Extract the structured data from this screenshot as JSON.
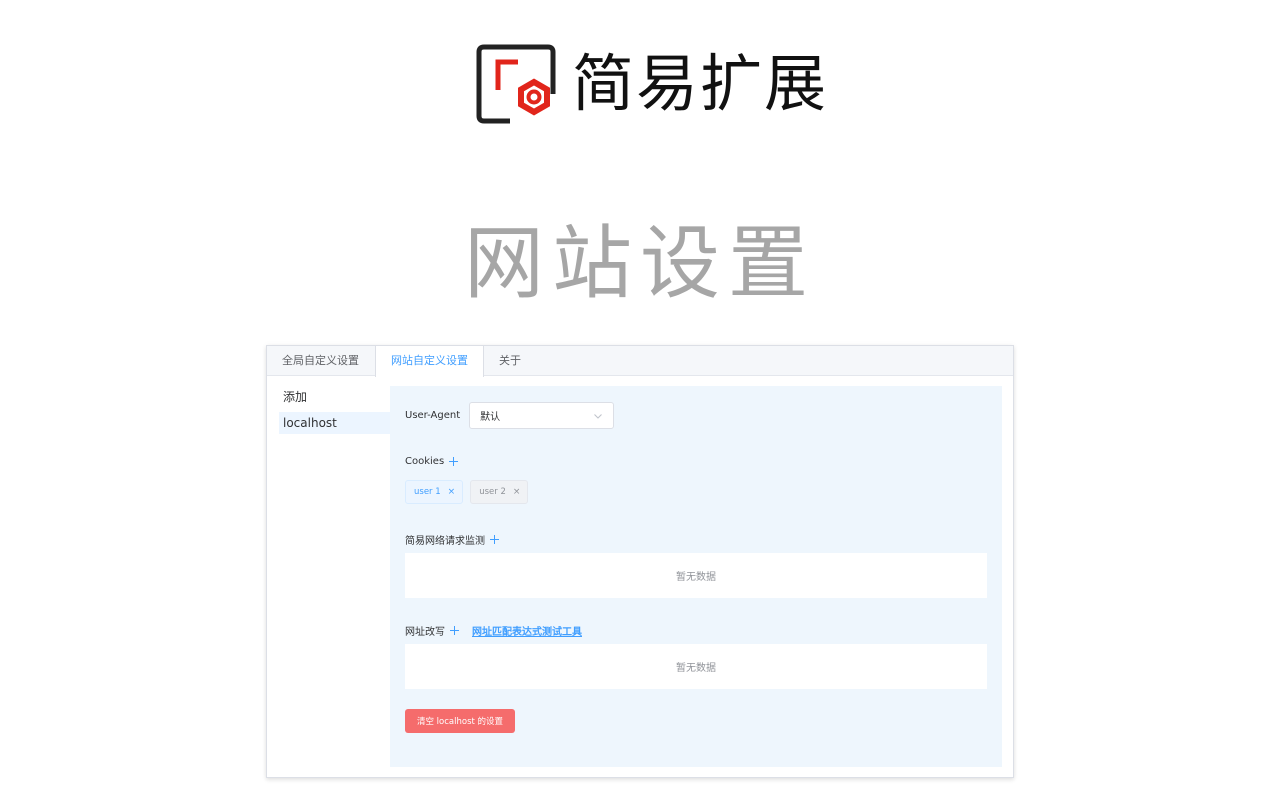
{
  "brand": {
    "name": "简易扩展",
    "logo_icon": "brand-logo-icon",
    "icon_colors": {
      "frame": "#222222",
      "accent": "#e1251b"
    }
  },
  "hero": {
    "title": "网站设置"
  },
  "tabs": [
    {
      "label": "全局自定义设置",
      "active": false
    },
    {
      "label": "网站自定义设置",
      "active": true
    },
    {
      "label": "关于",
      "active": false
    }
  ],
  "sidebar": {
    "items": [
      {
        "label": "添加",
        "active": false
      },
      {
        "label": "localhost",
        "active": true
      }
    ]
  },
  "user_agent": {
    "label": "User-Agent",
    "selected": "默认",
    "icon": "chevron-down-icon"
  },
  "cookies": {
    "label": "Cookies",
    "add_icon": "plus-icon",
    "tags": [
      {
        "label": "user 1",
        "active": true
      },
      {
        "label": "user 2",
        "active": false
      }
    ],
    "close_glyph": "×"
  },
  "network_monitor": {
    "label": "简易网络请求监测",
    "add_icon": "plus-icon",
    "empty_text": "暂无数据"
  },
  "url_rewrite": {
    "label": "网址改写",
    "add_icon": "plus-icon",
    "link_text": "网址匹配表达式测试工具",
    "empty_text": "暂无数据"
  },
  "clear_button": {
    "label": "清空 localhost 的设置"
  },
  "colors": {
    "primary": "#409eff",
    "danger": "#f56c6c",
    "content_bg": "#eef6fd",
    "muted_text": "#909399"
  }
}
